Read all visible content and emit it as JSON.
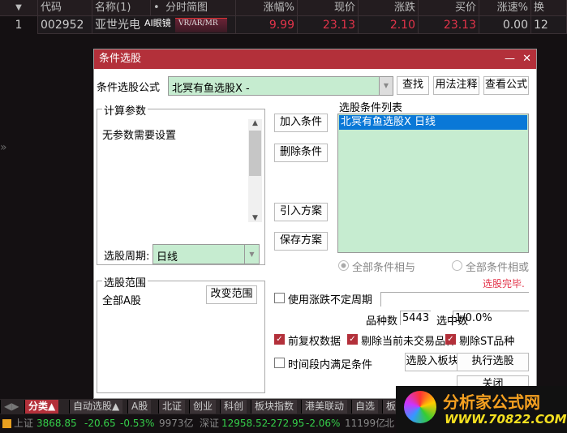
{
  "table": {
    "headers": [
      "▼",
      "代码",
      "名称(1)",
      "•",
      "分时简图",
      "涨幅%",
      "现价",
      "涨跌",
      "买价",
      "涨速%",
      "换"
    ],
    "row": {
      "index": "1",
      "code": "002952",
      "name": "亚世光电",
      "tag": "AI眼镜",
      "mini_chart": "VR/AR/MR",
      "change_pct": "9.99",
      "price": "23.13",
      "change": "2.10",
      "bid": "23.13",
      "speed": "0.00",
      "turnover": "12"
    }
  },
  "side_arrow": "»",
  "dialog": {
    "title": "条件选股",
    "minimize": "—",
    "close": "✕",
    "formula_label": "条件选股公式",
    "formula_value": "北冥有鱼选股X  -",
    "find": "查找",
    "usage": "用法注释",
    "view_formula": "查看公式",
    "params_group": "计算参数",
    "params_text": "无参数需要设置",
    "period_label": "选股周期:",
    "period_value": "日线",
    "add_condition": "加入条件",
    "delete_condition": "删除条件",
    "import_plan": "引入方案",
    "save_plan": "保存方案",
    "list_label": "选股条件列表",
    "list_items": [
      "北冥有鱼选股X  日线"
    ],
    "radio_and": "全部条件相与",
    "radio_or": "全部条件相或",
    "status": "选股完毕.",
    "scope_group": "选股范围",
    "scope_value": "全部A股",
    "change_scope": "改变范围",
    "use_uncertain_period": "使用涨跌不定周期",
    "count_label": "品种数",
    "count_value": "5443",
    "selected_label": "选中数",
    "selected_value": "1/0.0%",
    "forward_adjust": "前复权数据",
    "exclude_untraded": "剔除当前未交易品种",
    "exclude_st": "剔除ST品种",
    "time_range": "时间段内满足条件",
    "to_block": "选股入板块",
    "execute": "执行选股",
    "close_btn": "关闭"
  },
  "tabs": [
    "分类▲",
    "自动选股▲",
    "A股",
    "北证",
    "创业",
    "科创",
    "板块指数",
    "港美联动",
    "自选",
    "板"
  ],
  "status_bar": {
    "sh_label": "上证",
    "sh_value": "3868.85",
    "sh_change": "-20.65",
    "sh_pct": "-0.53%",
    "sh_amount": "9973亿",
    "sz_label": "深证",
    "sz_value": "12958.52",
    "sz_change": "-272.95",
    "sz_pct": "-2.06%",
    "sz_amount": "11199亿",
    "bz_label": "北"
  },
  "watermark": {
    "name": "分析家公式网",
    "url": "WWW.70822.COM"
  },
  "colors": {
    "accent": "#b3303a",
    "up": "#e3344a",
    "down": "#35d04a",
    "selection": "#0a78d7",
    "field": "#c6ecd0"
  }
}
